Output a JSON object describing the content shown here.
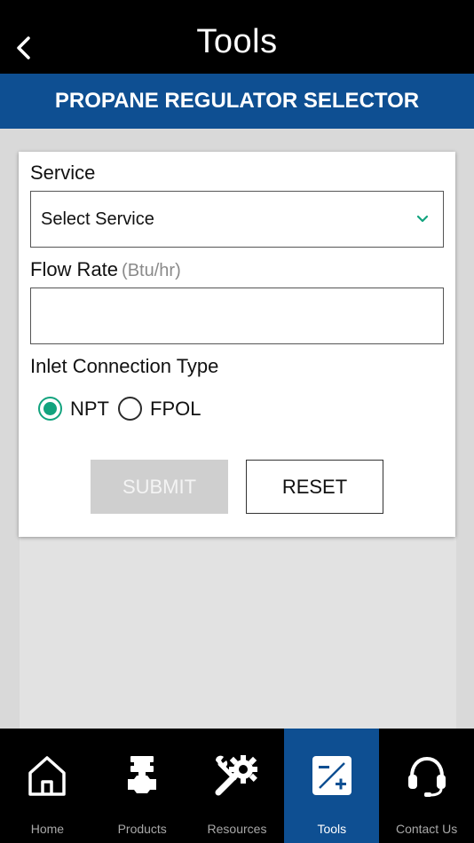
{
  "header": {
    "title": "Tools",
    "back_icon": "chevron-left-icon"
  },
  "section": {
    "title": "PROPANE REGULATOR SELECTOR"
  },
  "form": {
    "service": {
      "label": "Service",
      "selected_value": "Select Service",
      "chevron_color": "#12a37e"
    },
    "flow_rate": {
      "label": "Flow Rate",
      "unit": "(Btu/hr)",
      "value": ""
    },
    "inlet": {
      "label": "Inlet Connection Type",
      "options": [
        {
          "label": "NPT",
          "checked": true
        },
        {
          "label": "FPOL",
          "checked": false
        }
      ]
    },
    "submit_label": "SUBMIT",
    "reset_label": "RESET"
  },
  "bottom_nav": {
    "active": "Tools",
    "items": [
      {
        "label": "Home",
        "icon": "home-icon"
      },
      {
        "label": "Products",
        "icon": "valve-icon"
      },
      {
        "label": "Resources",
        "icon": "wrench-gear-icon"
      },
      {
        "label": "Tools",
        "icon": "calculator-icon"
      },
      {
        "label": "Contact Us",
        "icon": "headset-icon"
      }
    ]
  },
  "colors": {
    "brand_blue": "#0e4f92",
    "accent_green": "#12a37e",
    "nav_background": "#000000"
  }
}
